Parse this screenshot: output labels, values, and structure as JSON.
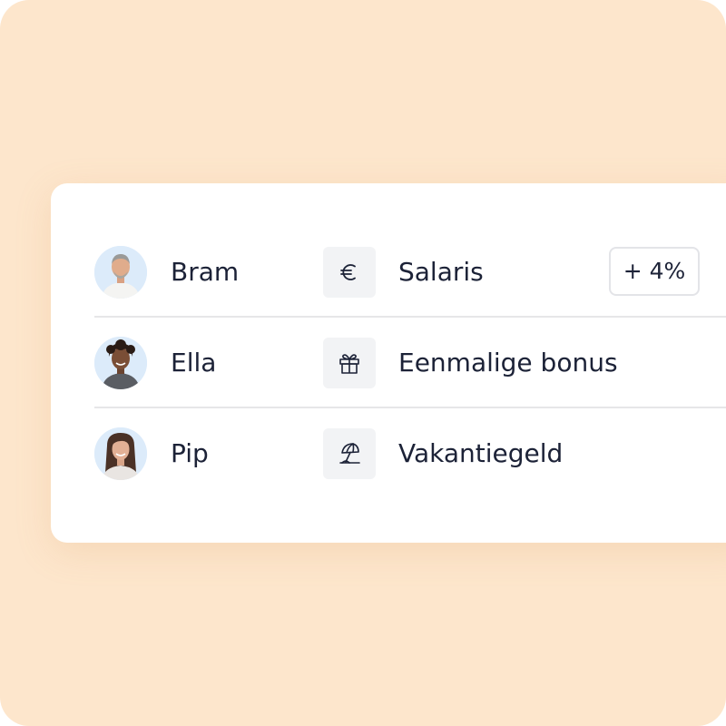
{
  "rows": [
    {
      "name": "Bram",
      "type_icon": "euro-icon",
      "type_label": "Salaris",
      "change": "+ 4%"
    },
    {
      "name": "Ella",
      "type_icon": "gift-icon",
      "type_label": "Eenmalige bonus"
    },
    {
      "name": "Pip",
      "type_icon": "beach-umbrella-icon",
      "type_label": "Vakantiegeld"
    }
  ],
  "colors": {
    "backdrop": "#fde6cc",
    "card": "#ffffff",
    "text": "#1c2237",
    "icon_tile": "#f2f3f5",
    "divider": "#e6e6e8",
    "avatar_bg": "#dcebfa"
  }
}
